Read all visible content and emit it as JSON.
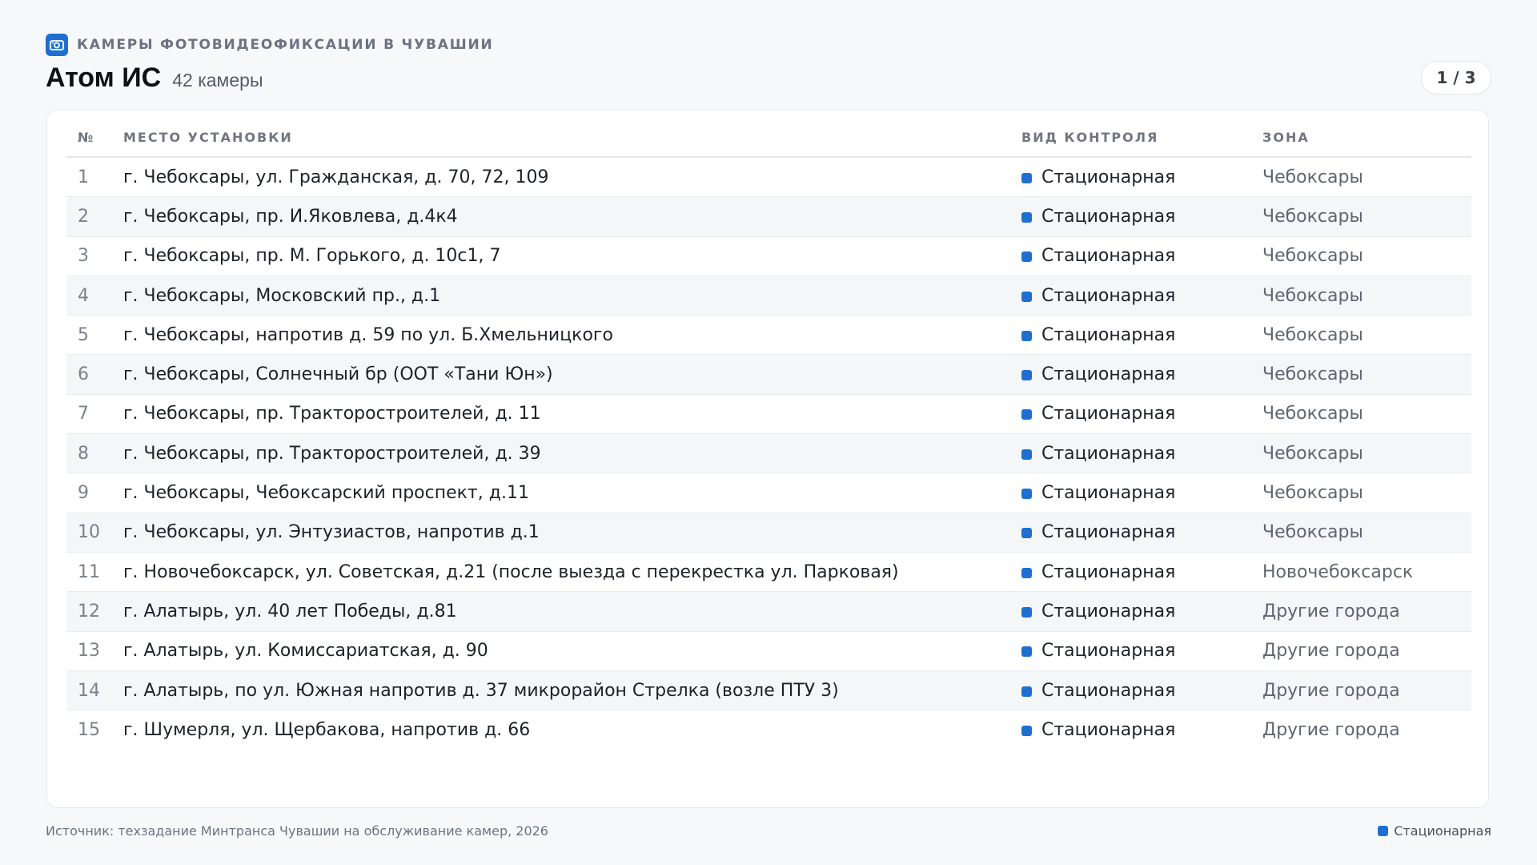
{
  "header": {
    "kicker": "КАМЕРЫ ФОТОВИДЕОФИКСАЦИИ В ЧУВАШИИ",
    "title": "Атом ИС",
    "subtitle": "42 камеры",
    "page_indicator": "1 / 3"
  },
  "table": {
    "columns": [
      "№",
      "МЕСТО УСТАНОВКИ",
      "ВИД КОНТРОЛЯ",
      "ЗОНА"
    ],
    "rows": [
      {
        "num": "1",
        "place": "г. Чебоксары, ул. Гражданская, д. 70, 72, 109",
        "kind": "Стационарная",
        "zone": "Чебоксары"
      },
      {
        "num": "2",
        "place": "г. Чебоксары, пр. И.Яковлева, д.4к4",
        "kind": "Стационарная",
        "zone": "Чебоксары"
      },
      {
        "num": "3",
        "place": "г. Чебоксары, пр. М. Горького, д. 10с1, 7",
        "kind": "Стационарная",
        "zone": "Чебоксары"
      },
      {
        "num": "4",
        "place": "г. Чебоксары, Московский пр., д.1",
        "kind": "Стационарная",
        "zone": "Чебоксары"
      },
      {
        "num": "5",
        "place": "г. Чебоксары, напротив д. 59 по ул. Б.Хмельницкого",
        "kind": "Стационарная",
        "zone": "Чебоксары"
      },
      {
        "num": "6",
        "place": "г. Чебоксары, Солнечный бр (ООТ «Тани Юн»)",
        "kind": "Стационарная",
        "zone": "Чебоксары"
      },
      {
        "num": "7",
        "place": "г. Чебоксары, пр. Тракторостроителей, д. 11",
        "kind": "Стационарная",
        "zone": "Чебоксары"
      },
      {
        "num": "8",
        "place": "г. Чебоксары, пр. Тракторостроителей, д. 39",
        "kind": "Стационарная",
        "zone": "Чебоксары"
      },
      {
        "num": "9",
        "place": "г. Чебоксары, Чебоксарский проспект, д.11",
        "kind": "Стационарная",
        "zone": "Чебоксары"
      },
      {
        "num": "10",
        "place": "г. Чебоксары, ул. Энтузиастов, напротив д.1",
        "kind": "Стационарная",
        "zone": "Чебоксары"
      },
      {
        "num": "11",
        "place": "г. Новочебоксарск, ул. Советская, д.21 (после выезда с перекрестка ул. Парковая)",
        "kind": "Стационарная",
        "zone": "Новочебоксарск"
      },
      {
        "num": "12",
        "place": "г. Алатырь, ул. 40 лет Победы, д.81",
        "kind": "Стационарная",
        "zone": "Другие города"
      },
      {
        "num": "13",
        "place": "г. Алатырь, ул. Комиссариатская, д. 90",
        "kind": "Стационарная",
        "zone": "Другие города"
      },
      {
        "num": "14",
        "place": "г. Алатырь, по ул. Южная напротив д. 37 микрорайон Стрелка (возле ПТУ 3)",
        "kind": "Стационарная",
        "zone": "Другие города"
      },
      {
        "num": "15",
        "place": "г. Шумерля, ул. Щербакова, напротив д. 66",
        "kind": "Стационарная",
        "zone": "Другие города"
      }
    ]
  },
  "footer": {
    "source": "Источник: техзадание Минтранса Чувашии на обслуживание камер, 2026",
    "legend_label": "Стационарная"
  },
  "colors": {
    "accent": "#1f6fd1"
  },
  "icons": {
    "kicker": "camera-icon"
  }
}
